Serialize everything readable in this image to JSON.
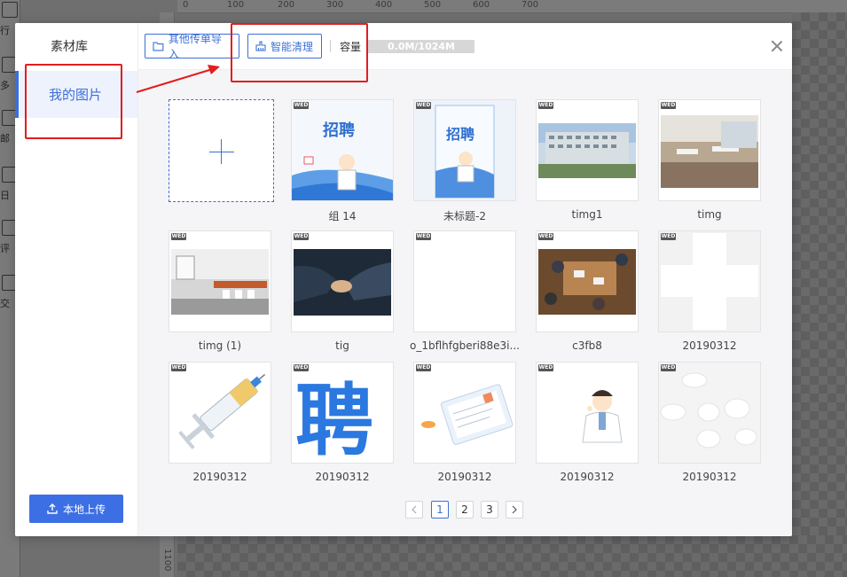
{
  "background": {
    "tools": [
      "行",
      "多",
      "邮",
      "日",
      "评",
      "交"
    ],
    "ruler_top": [
      "0",
      "100",
      "200",
      "300",
      "400",
      "500",
      "600",
      "700"
    ],
    "ruler_left": [
      "1100"
    ]
  },
  "sidebar": {
    "title": "素材库",
    "active_item": "我的图片",
    "upload_label": "本地上传"
  },
  "topbar": {
    "import_label": "其他传单导入",
    "clean_label": "智能清理",
    "capacity_label": "容量",
    "capacity_text": "0.0M/1024M",
    "capacity_fraction": 0.0
  },
  "badge_text": "WED",
  "tiles": [
    {
      "caption": "组 14",
      "art": "poster-recruit-a"
    },
    {
      "caption": "未标题-2",
      "art": "poster-recruit-b"
    },
    {
      "caption": "timg1",
      "art": "photo-building"
    },
    {
      "caption": "timg",
      "art": "photo-office"
    },
    {
      "caption": "timg (1)",
      "art": "photo-meeting-room"
    },
    {
      "caption": "tig",
      "art": "photo-handshake"
    },
    {
      "caption": "o_1bflhfgberi88e3i...",
      "art": "blank"
    },
    {
      "caption": "c3fb8",
      "art": "photo-team-table"
    },
    {
      "caption": "20190312",
      "art": "white-cross"
    },
    {
      "caption": "20190312",
      "art": "syringe"
    },
    {
      "caption": "20190312",
      "art": "pin-character"
    },
    {
      "caption": "20190312",
      "art": "medical-card"
    },
    {
      "caption": "20190312",
      "art": "doctor"
    },
    {
      "caption": "20190312",
      "art": "pills"
    }
  ],
  "pagination": {
    "pages": [
      "1",
      "2",
      "3"
    ],
    "current": "1"
  },
  "colors": {
    "accent": "#3b6fd8",
    "upload_button": "#3d6fe4",
    "annotation": "#e31d1d"
  }
}
